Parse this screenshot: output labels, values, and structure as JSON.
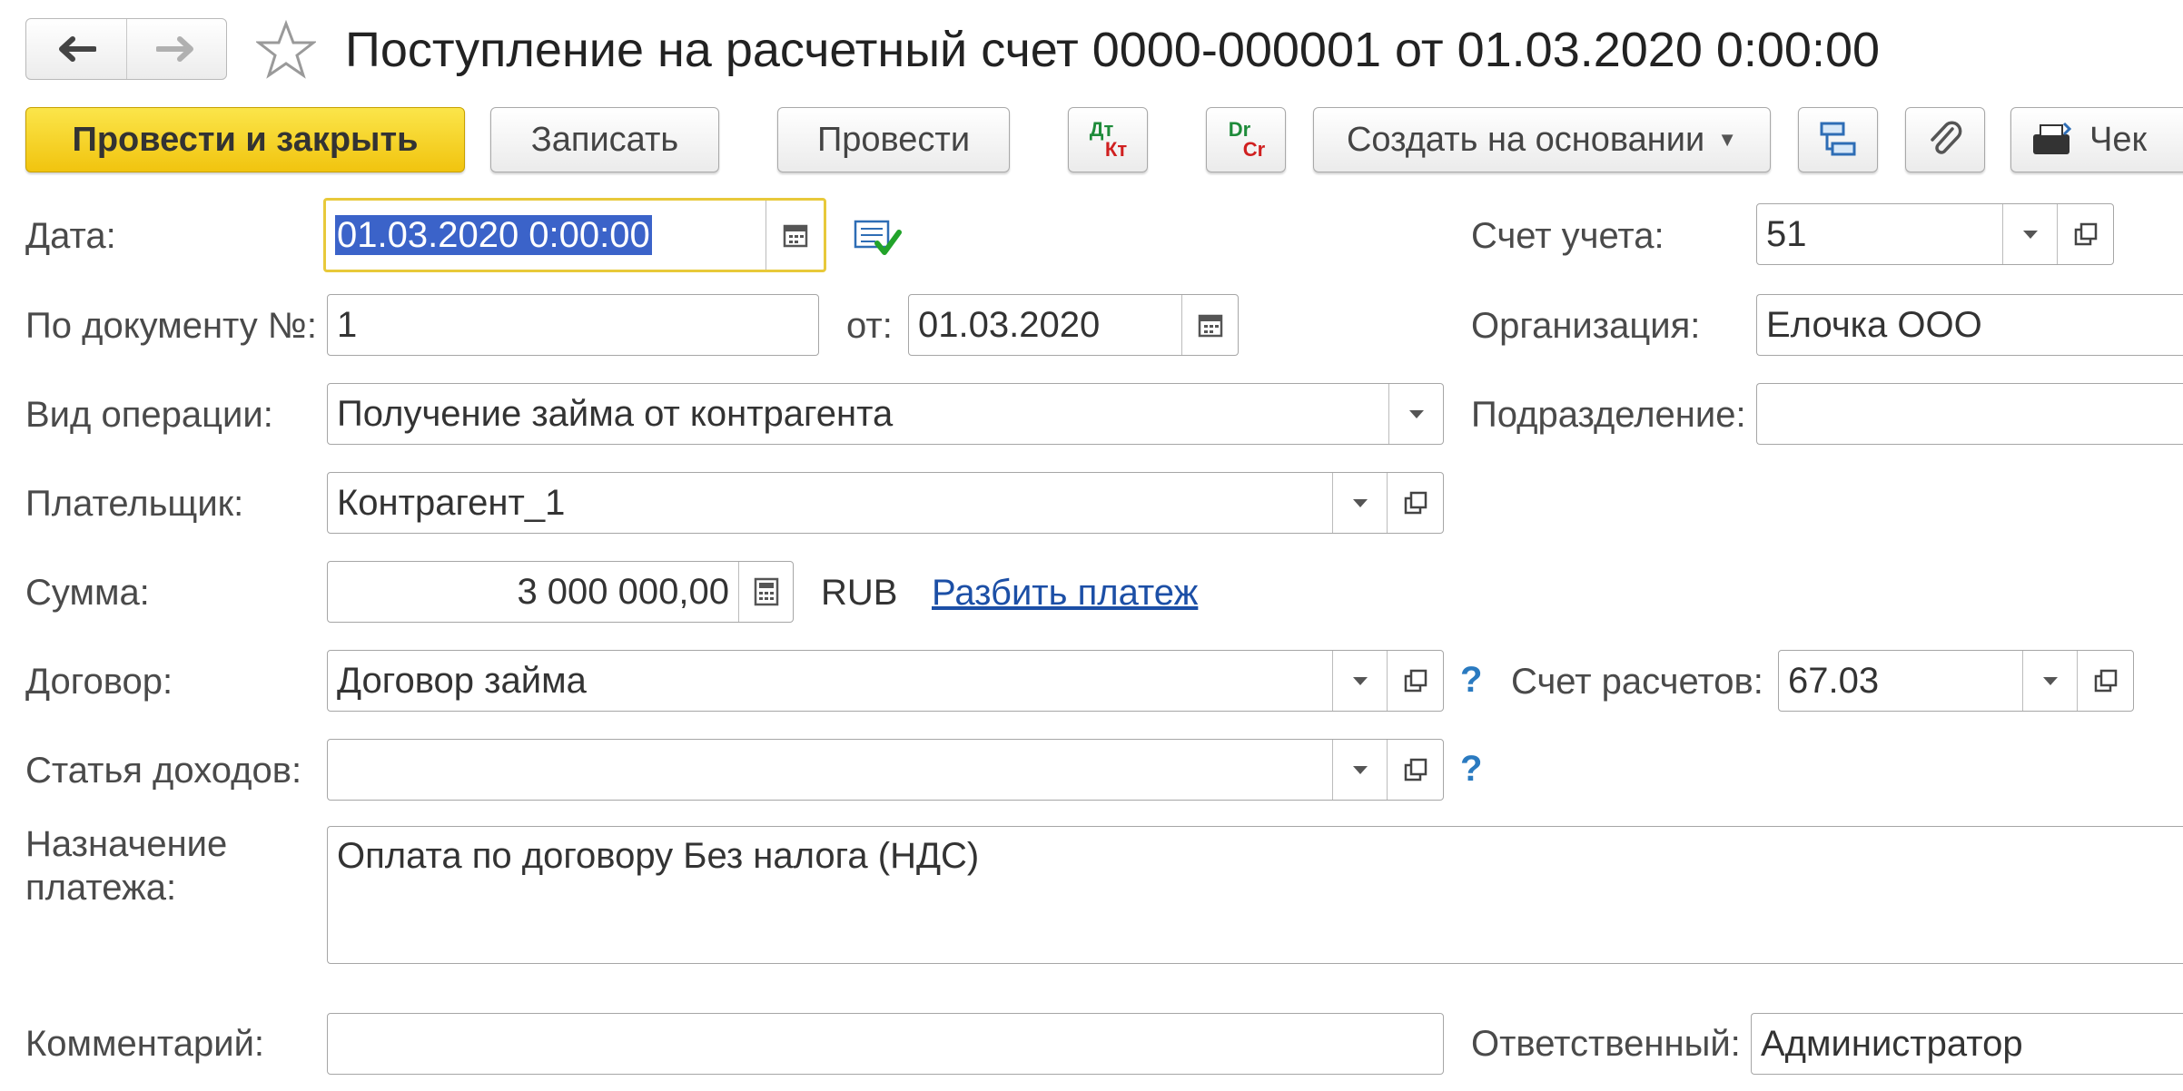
{
  "window": {
    "title": "Поступление на расчетный счет 0000-000001 от 01.03.2020 0:00:00"
  },
  "toolbar": {
    "post_and_close": "Провести и закрыть",
    "save": "Записать",
    "post": "Провести",
    "dtkt_top": "Дт",
    "dtkt_bottom": "Кт",
    "drcr_top": "Dr",
    "drcr_bottom": "Cr",
    "create_based_on": "Создать на основании",
    "receipt": "Чек"
  },
  "form": {
    "date": {
      "label": "Дата:",
      "value": "01.03.2020  0:00:00"
    },
    "doc_number": {
      "label": "По документу №:",
      "value": "1"
    },
    "doc_date": {
      "label": "от:",
      "value": "01.03.2020"
    },
    "operation_type": {
      "label": "Вид операции:",
      "value": "Получение займа от контрагента"
    },
    "payer": {
      "label": "Плательщик:",
      "value": "Контрагент_1"
    },
    "amount": {
      "label": "Сумма:",
      "value": "3 000 000,00",
      "currency": "RUB",
      "split_link": "Разбить платеж"
    },
    "contract": {
      "label": "Договор:",
      "value": "Договор займа",
      "help": "?"
    },
    "income_item": {
      "label": "Статья доходов:",
      "value": "",
      "help": "?"
    },
    "purpose": {
      "label_line1": "Назначение",
      "label_line2": "платежа:",
      "value": "Оплата по договору  Без налога (НДС)"
    },
    "comment": {
      "label": "Комментарий:",
      "value": ""
    },
    "account": {
      "label": "Счет учета:",
      "value": "51"
    },
    "organization": {
      "label": "Организация:",
      "value": "Елочка ООО"
    },
    "department": {
      "label": "Подразделение:",
      "value": ""
    },
    "settlement_account": {
      "label": "Счет расчетов:",
      "value": "67.03"
    },
    "responsible": {
      "label": "Ответственный:",
      "value": "Администратор"
    }
  },
  "colors": {
    "primary_button": "#f1c40f",
    "focus_border": "#e8c93a",
    "link": "#1c4fa6",
    "selection": "#3b63c9"
  }
}
